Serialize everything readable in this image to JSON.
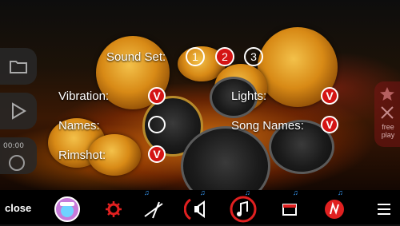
{
  "settings": {
    "sound_set_label": "Sound Set:",
    "sound_sets": [
      "1",
      "2",
      "3"
    ],
    "selected_sound_set": "2",
    "vibration_label": "Vibration:",
    "vibration_on": true,
    "names_label": "Names:",
    "names_on": false,
    "rimshot_label": "Rimshot:",
    "rimshot_on": true,
    "lights_label": "Lights:",
    "lights_on": true,
    "song_names_label": "Song Names:",
    "song_names_on": true,
    "check_glyph": "V"
  },
  "side": {
    "time_readout": "00:00",
    "free_play_line1": "free",
    "free_play_line2": "play"
  },
  "toolbar": {
    "close_label": "close",
    "icons": [
      "badge-icon",
      "gear-icon",
      "drumstick-icon",
      "speaker-icon",
      "music-note-icon",
      "record-icon",
      "logo-icon",
      "menu-icon"
    ]
  },
  "colors": {
    "accent": "#d41414",
    "toolbar_bg": "#000000",
    "note_blue": "#3aa0ff"
  }
}
